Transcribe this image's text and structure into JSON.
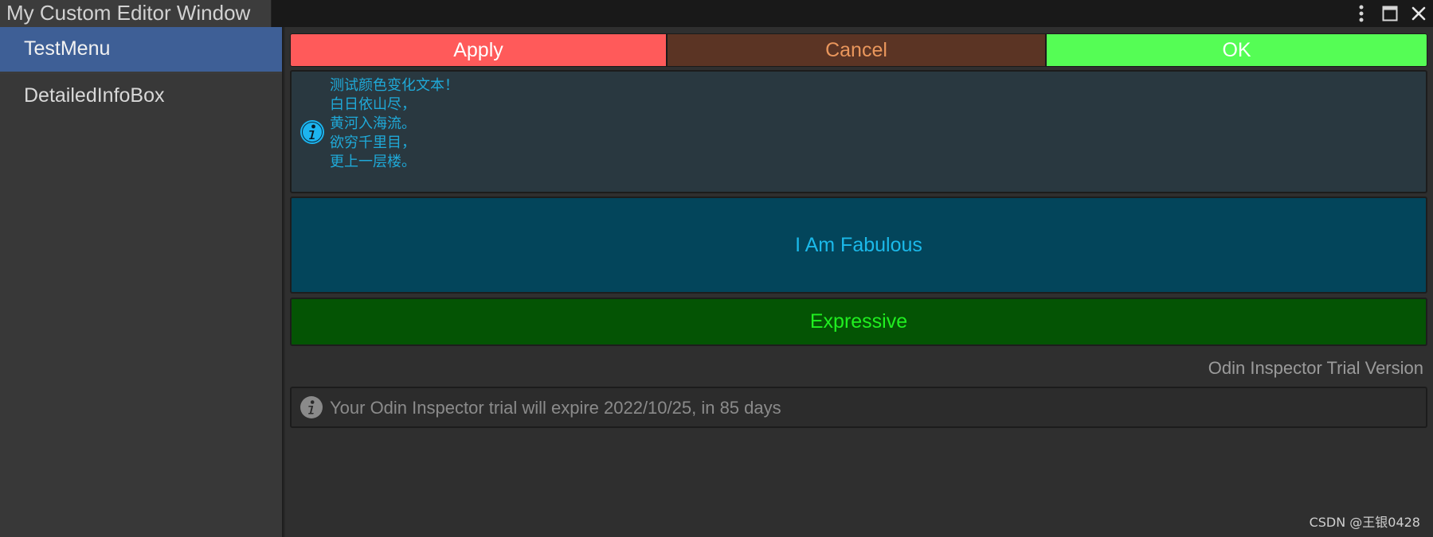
{
  "window": {
    "title": "My Custom Editor Window",
    "icons": [
      "kebab-menu-icon",
      "maximize-icon",
      "close-icon"
    ]
  },
  "sidebar": {
    "items": [
      {
        "label": "TestMenu",
        "selected": true
      },
      {
        "label": "DetailedInfoBox",
        "selected": false
      }
    ]
  },
  "buttons": {
    "apply": {
      "label": "Apply",
      "color": "#ff5a5a"
    },
    "cancel": {
      "label": "Cancel",
      "color": "#5b3424"
    },
    "ok": {
      "label": "OK",
      "color": "#55fd55"
    }
  },
  "info_box": {
    "icon": "info-icon",
    "lines": [
      "测试颜色变化文本！",
      "白日依山尽，",
      "黄河入海流。",
      "欲穷千里目，",
      "更上一层楼。"
    ],
    "text_color": "#1fa9d8"
  },
  "fabulous_button": {
    "label": "I Am Fabulous",
    "color": "#03455b",
    "text_color": "#1bb9ea"
  },
  "expressive_button": {
    "label": "Expressive",
    "color": "#045404",
    "text_color": "#20ef20"
  },
  "trial": {
    "title": "Odin Inspector Trial Version",
    "message": "Your Odin Inspector trial will expire 2022/10/25, in 85 days",
    "icon": "info-icon"
  },
  "watermark": "CSDN @王银0428"
}
